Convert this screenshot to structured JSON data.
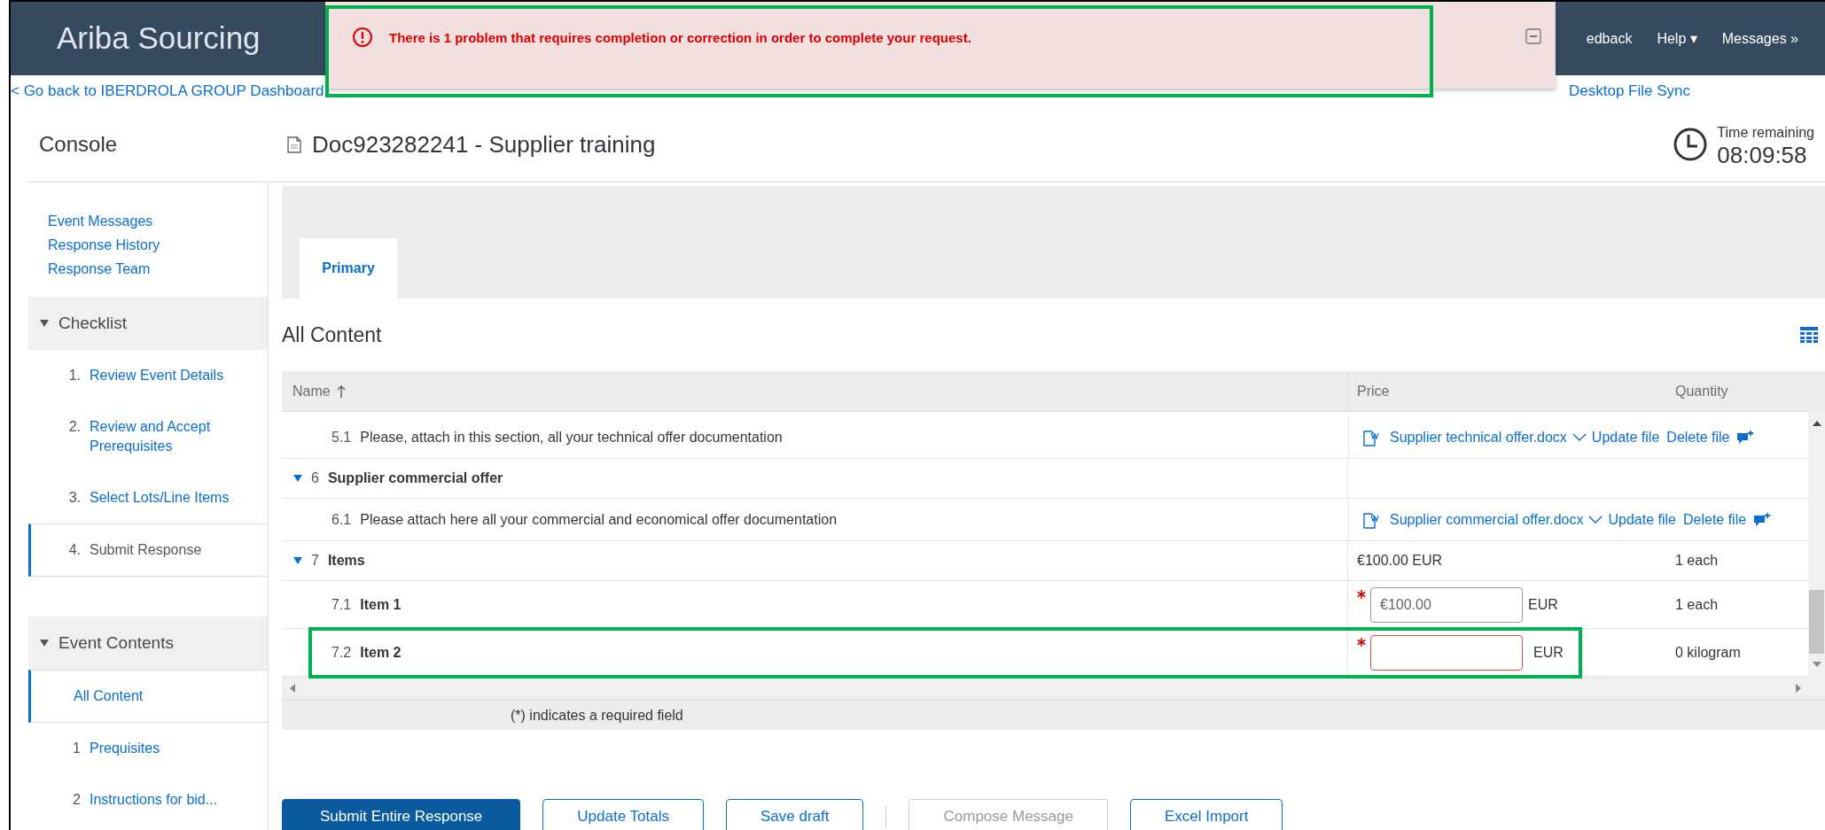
{
  "header": {
    "app_title": "Ariba Sourcing",
    "links": [
      {
        "label": "edback"
      },
      {
        "label": "Help",
        "caret": "▾"
      },
      {
        "label": "Messages",
        "caret": "»"
      }
    ]
  },
  "message": {
    "text": "There is 1 problem that requires completion or correction in order to complete your request.",
    "highlighted": true
  },
  "back_link": "< Go back to IBERDROLA GROUP Dashboard",
  "file_sync_link": "Desktop File Sync",
  "console_title": "Console",
  "document_title": "Doc923282241 - Supplier training",
  "timer": {
    "label": "Time remaining",
    "value": "08:09:58"
  },
  "sidebar": {
    "links": [
      "Event Messages",
      "Response History",
      "Response Team"
    ],
    "sections": [
      {
        "title": "Checklist",
        "expanded": true,
        "items": [
          {
            "number": "1.",
            "label": "Review Event Details",
            "link": true,
            "selected": false
          },
          {
            "number": "2.",
            "label": "Review and Accept Prerequisites",
            "link": true,
            "selected": false
          },
          {
            "number": "3.",
            "label": "Select Lots/Line Items",
            "link": true,
            "selected": false
          },
          {
            "number": "4.",
            "label": "Submit Response",
            "link": false,
            "selected": true
          }
        ]
      },
      {
        "title": "Event Contents",
        "expanded": true,
        "items": [
          {
            "label": "All Content",
            "link": true,
            "selected": true
          },
          {
            "number": "1",
            "label": "Prequisites",
            "link": true,
            "selected": false
          },
          {
            "number": "2",
            "label": "Instructions for bid...",
            "link": true,
            "selected": false
          }
        ]
      }
    ]
  },
  "tabs": [
    {
      "label": "Primary",
      "selected": true
    }
  ],
  "content_title": "All Content",
  "table": {
    "columns": [
      {
        "label": "Name",
        "sorted": true
      },
      {
        "label": "Price",
        "sorted": false
      },
      {
        "label": "Quantity",
        "sorted": false
      }
    ],
    "rows": [
      {
        "kind": "attachment",
        "number": "5.1",
        "name": "Please, attach in this section, all your technical offer documentation",
        "file": "Supplier technical offer.docx",
        "actions": [
          "Update file",
          "Delete file"
        ],
        "highlighted": false
      },
      {
        "kind": "section",
        "number": "6",
        "name": "Supplier commercial offer",
        "expanded": true,
        "highlighted": false
      },
      {
        "kind": "attachment",
        "number": "6.1",
        "name": "Please attach here all your commercial and economical offer documentation",
        "file": "Supplier commercial offer.docx",
        "actions": [
          "Update file",
          "Delete file"
        ],
        "highlighted": false
      },
      {
        "kind": "section",
        "number": "7",
        "name": "Items",
        "expanded": true,
        "price": "€100.00 EUR",
        "quantity": "1 each",
        "highlighted": false
      },
      {
        "kind": "line_item",
        "number": "7.1",
        "name": "Item 1",
        "required": true,
        "value": "€100.00",
        "currency": "EUR",
        "error": false,
        "quantity": "1 each",
        "highlighted": false
      },
      {
        "kind": "line_item",
        "number": "7.2",
        "name": "Item 2",
        "required": true,
        "currency": "EUR",
        "error": true,
        "quantity": "0 kilogram",
        "highlighted": true
      }
    ],
    "footer_note": "(*) indicates a required field"
  },
  "buttons": [
    {
      "label": "Submit Entire Response",
      "kind": "primary",
      "disabled": false
    },
    {
      "label": "Update Totals",
      "kind": "secondary",
      "disabled": false
    },
    {
      "label": "Save draft",
      "kind": "secondary",
      "disabled": false
    },
    {
      "kind": "separator"
    },
    {
      "label": "Compose Message",
      "kind": "secondary",
      "disabled": true
    },
    {
      "label": "Excel Import",
      "kind": "secondary",
      "disabled": false
    }
  ]
}
